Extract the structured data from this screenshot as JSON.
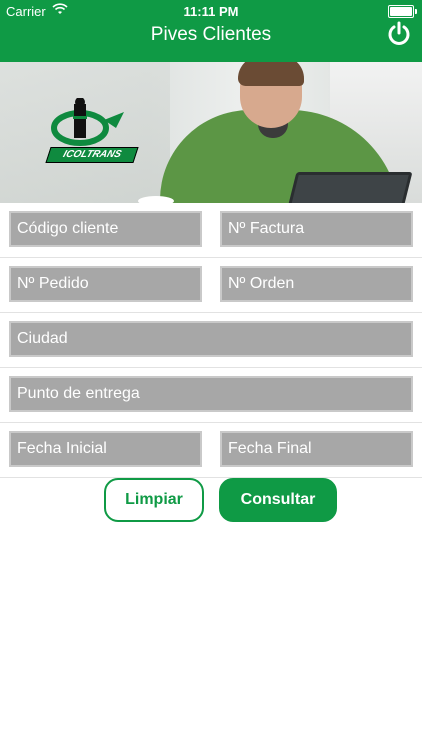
{
  "status_bar": {
    "carrier": "Carrier",
    "time": "11:11 PM"
  },
  "header": {
    "title": "Pives Clientes"
  },
  "logo": {
    "text": "ICOLTRANS"
  },
  "form": {
    "codigo_cliente": "Código cliente",
    "factura": "Nº Factura",
    "pedido": "Nº Pedido",
    "orden": "Nº Orden",
    "ciudad": "Ciudad",
    "punto_entrega": "Punto de entrega",
    "fecha_inicial": "Fecha Inicial",
    "fecha_final": "Fecha Final"
  },
  "buttons": {
    "clear": "Limpiar",
    "query": "Consultar"
  },
  "colors": {
    "brand": "#0f9a45",
    "field_bg": "#a7a7a7"
  },
  "icons": {
    "power": "power-icon",
    "wifi": "wifi-icon",
    "battery": "battery-icon"
  }
}
